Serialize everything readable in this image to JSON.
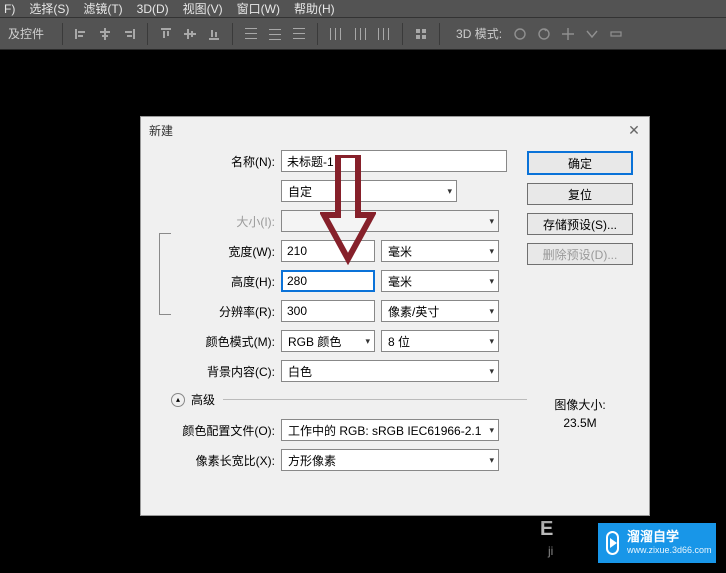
{
  "menubar": {
    "layer": "F)",
    "select": "选择(S)",
    "filter": "滤镜(T)",
    "three_d": "3D(D)",
    "view": "视图(V)",
    "window": "窗口(W)",
    "help": "帮助(H)"
  },
  "toolbar": {
    "left_label": "及控件",
    "mode_label": "3D 模式:"
  },
  "dialog": {
    "title": "新建",
    "name_label": "名称(N):",
    "name_value": "未标题-1",
    "preset_value": "自定",
    "size_label": "大小(I):",
    "size_value": "",
    "width_label": "宽度(W):",
    "width_value": "210",
    "width_unit": "毫米",
    "height_label": "高度(H):",
    "height_value": "280",
    "height_unit": "毫米",
    "res_label": "分辨率(R):",
    "res_value": "300",
    "res_unit": "像素/英寸",
    "mode_label": "颜色模式(M):",
    "mode_value": "RGB 颜色",
    "depth_value": "8 位",
    "bg_label": "背景内容(C):",
    "bg_value": "白色",
    "advanced_label": "高级",
    "profile_label": "颜色配置文件(O):",
    "profile_value": "工作中的 RGB: sRGB IEC61966-2.1",
    "aspect_label": "像素长宽比(X):",
    "aspect_value": "方形像素",
    "buttons": {
      "ok": "确定",
      "cancel": "复位",
      "save_preset": "存储预设(S)...",
      "delete_preset": "删除预设(D)..."
    },
    "imgsize_label": "图像大小:",
    "imgsize_value": "23.5M"
  },
  "watermark": {
    "title": "溜溜自学",
    "url": "www.zixue.3d66.com"
  },
  "bg": {
    "text1": "E",
    "text2": "ji"
  }
}
